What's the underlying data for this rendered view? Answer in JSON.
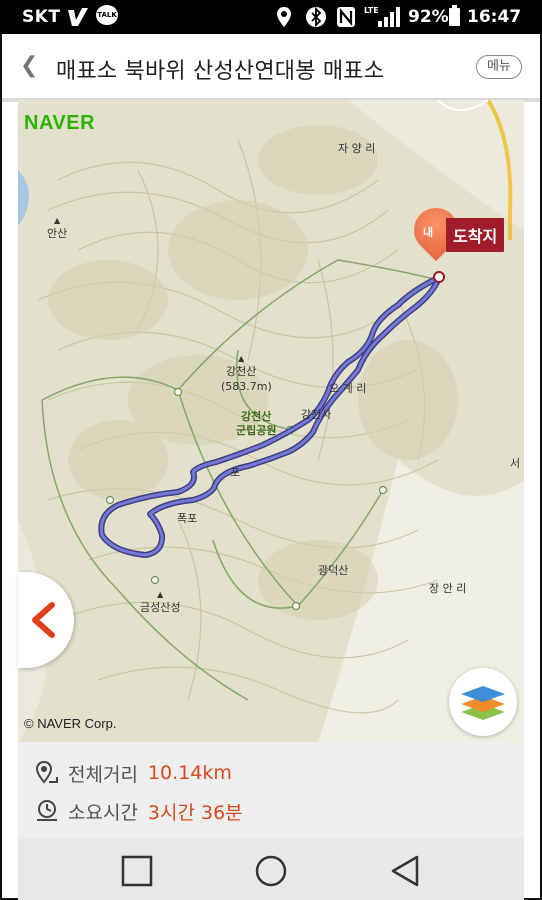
{
  "status_bar": {
    "carrier": "SKT",
    "kakao_badge": "TALK",
    "network_badge": "LTE",
    "battery": "92%",
    "time": "16:47"
  },
  "header": {
    "title": "매표소 북바위 산성산연대봉 매표소",
    "menu_label": "메뉴"
  },
  "map": {
    "brand": "NAVER",
    "copyright": "© NAVER Corp.",
    "arrival_label": "도착지",
    "pin_text": "내",
    "places": {
      "jayang": "자 양 리",
      "ansan": "안산",
      "gangcheonsan": "강천산",
      "gangcheonsan_alt": "(583.7m)",
      "ogye": "오 계 리",
      "park_line1": "강천산",
      "park_line2": "군립공원",
      "gangcheonsa": "강천사",
      "po": "포",
      "pokpo": "폭포",
      "gwangdeoksan": "광덕산",
      "jangan": "장 안 리",
      "geumseongsanseong": "금성산성",
      "seo": "서"
    }
  },
  "info": {
    "distance_label": "전체거리",
    "distance_value": "10.14km",
    "time_label": "소요시간",
    "time_value": "3시간 36분"
  },
  "colors": {
    "accent": "#d64a1e",
    "route": "#4a4fb8",
    "arrival_bg": "#a01c2b",
    "naver_green": "#2db400"
  }
}
